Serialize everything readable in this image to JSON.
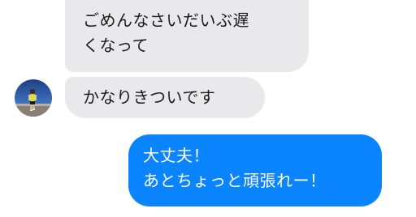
{
  "conversation": {
    "messages": [
      {
        "sender": "other",
        "lines": [
          "ごめんなさいだいぶ遅",
          "くなって"
        ]
      },
      {
        "sender": "other",
        "lines": [
          "かなりきついです"
        ]
      },
      {
        "sender": "me",
        "lines": [
          "大丈夫！",
          "あとちょっと頑張れー！"
        ]
      }
    ]
  },
  "colors": {
    "incoming_bubble": "#e9e9eb",
    "outgoing_bubble": "#0a84ff",
    "incoming_text": "#1c1c1e",
    "outgoing_text": "#ffffff"
  },
  "avatar": {
    "icon": "runner-photo-avatar"
  }
}
